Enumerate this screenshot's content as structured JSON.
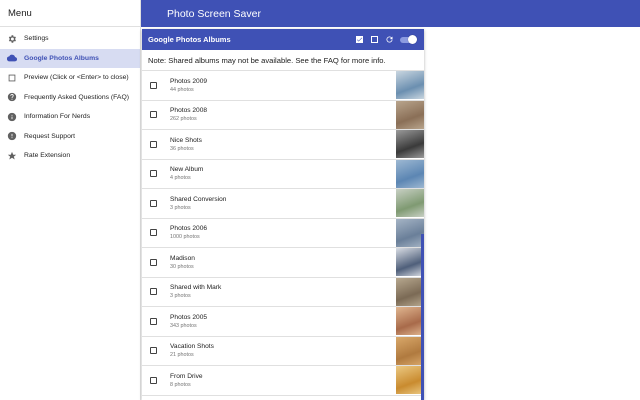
{
  "sidebar": {
    "header": "Menu",
    "items": [
      {
        "label": "Settings",
        "icon": "gear-icon"
      },
      {
        "label": "Google Photos Albums",
        "icon": "cloud-icon",
        "active": true
      },
      {
        "label": "Preview (Click or <Enter> to close)",
        "icon": "preview-icon"
      },
      {
        "label": "Frequently Asked Questions (FAQ)",
        "icon": "help-icon"
      },
      {
        "label": "Information For Nerds",
        "icon": "info-icon"
      },
      {
        "label": "Request Support",
        "icon": "support-icon"
      },
      {
        "label": "Rate Extension",
        "icon": "star-icon"
      }
    ]
  },
  "appbar": {
    "title": "Photo Screen Saver"
  },
  "card": {
    "title": "Google Photos Albums",
    "note": "Note: Shared albums may not be available. See the FAQ for more info."
  },
  "albums": [
    {
      "name": "Photos 2009",
      "count": "44 photos",
      "thumb": [
        "#6b8fb0",
        "#c9d6e0"
      ]
    },
    {
      "name": "Photos 2008",
      "count": "262 photos",
      "thumb": [
        "#8a6f57",
        "#b9a58d"
      ]
    },
    {
      "name": "Nice Shots",
      "count": "36 photos",
      "thumb": [
        "#3a3a3a",
        "#9a9a9a"
      ]
    },
    {
      "name": "New Album",
      "count": "4 photos",
      "thumb": [
        "#5c86b3",
        "#9db8d2"
      ]
    },
    {
      "name": "Shared Conversion",
      "count": "3 photos",
      "thumb": [
        "#7f9a72",
        "#c8d0c4"
      ]
    },
    {
      "name": "Photos 2006",
      "count": "1000 photos",
      "thumb": [
        "#6a7f99",
        "#a5b4c5"
      ]
    },
    {
      "name": "Madison",
      "count": "30 photos",
      "thumb": [
        "#4f5f7a",
        "#d9dde4"
      ]
    },
    {
      "name": "Shared with Mark",
      "count": "3 photos",
      "thumb": [
        "#7b6a55",
        "#b7a88f"
      ]
    },
    {
      "name": "Photos 2005",
      "count": "343 photos",
      "thumb": [
        "#a86a4a",
        "#e0b690"
      ]
    },
    {
      "name": "Vacation Shots",
      "count": "21 photos",
      "thumb": [
        "#b07a3f",
        "#d9a86a"
      ]
    },
    {
      "name": "From Drive",
      "count": "8 photos",
      "thumb": [
        "#c98b2f",
        "#ebc983"
      ]
    }
  ],
  "colors": {
    "primary": "#3f51b5",
    "activeBg": "#d7dcf2"
  }
}
